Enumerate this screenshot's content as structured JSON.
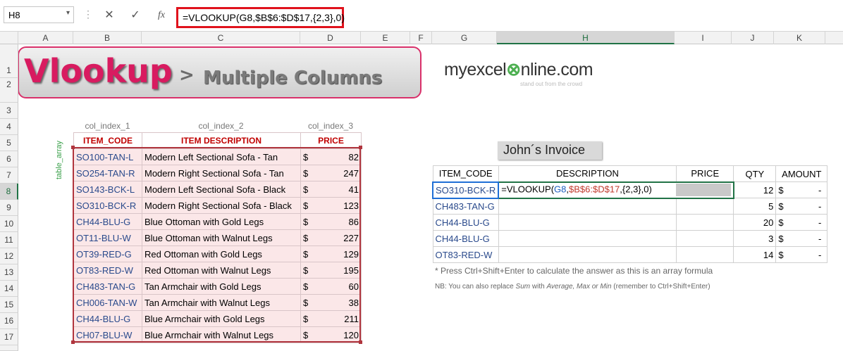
{
  "formula_bar": {
    "name_box": "H8",
    "cancel_icon": "✕",
    "enter_icon": "✓",
    "fx_label": "fx",
    "formula": "=VLOOKUP(G8,$B$6:$D$17,{2,3},0)"
  },
  "columns": [
    "A",
    "B",
    "C",
    "D",
    "E",
    "F",
    "G",
    "H",
    "I",
    "J",
    "K"
  ],
  "rows": [
    "1",
    "2",
    "3",
    "4",
    "5",
    "6",
    "7",
    "8",
    "9",
    "10",
    "11",
    "12",
    "13",
    "14",
    "15",
    "16",
    "17"
  ],
  "selected_cell": {
    "column": "H",
    "row": "8"
  },
  "banner": {
    "main": "Vlookup",
    "arrow": ">",
    "sub": "Multiple Columns"
  },
  "logo": {
    "pre": "myexcel",
    "x": "⊗",
    "post": "nline.com",
    "tagline": "stand out from the crowd"
  },
  "lookup": {
    "index_labels": [
      "col_index_1",
      "col_index_2",
      "col_index_3"
    ],
    "headers": [
      "ITEM_CODE",
      "ITEM DESCRIPTION",
      "PRICE"
    ],
    "array_label": "table_array",
    "currency": "$",
    "rows": [
      {
        "code": "SO100-TAN-L",
        "desc": "Modern Left Sectional Sofa - Tan",
        "price": "82"
      },
      {
        "code": "SO254-TAN-R",
        "desc": "Modern Right Sectional Sofa - Tan",
        "price": "247"
      },
      {
        "code": "SO143-BCK-L",
        "desc": "Modern Left Sectional Sofa - Black",
        "price": "41"
      },
      {
        "code": "SO310-BCK-R",
        "desc": "Modern Right Sectional Sofa - Black",
        "price": "123"
      },
      {
        "code": "CH44-BLU-G",
        "desc": "Blue Ottoman with Gold Legs",
        "price": "86"
      },
      {
        "code": "OT11-BLU-W",
        "desc": "Blue Ottoman with Walnut Legs",
        "price": "227"
      },
      {
        "code": "OT39-RED-G",
        "desc": "Red Ottoman with Gold Legs",
        "price": "129"
      },
      {
        "code": "OT83-RED-W",
        "desc": "Red Ottoman with Walnut Legs",
        "price": "195"
      },
      {
        "code": "CH483-TAN-G",
        "desc": "Tan Armchair with Gold Legs",
        "price": "60"
      },
      {
        "code": "CH006-TAN-W",
        "desc": "Tan Armchair with Walnut Legs",
        "price": "38"
      },
      {
        "code": "CH44-BLU-G",
        "desc": "Blue Armchair with Gold Legs",
        "price": "211"
      },
      {
        "code": "CH07-BLU-W",
        "desc": "Blue Armchair with Walnut Legs",
        "price": "120"
      }
    ]
  },
  "invoice": {
    "title": "John´s Invoice",
    "headers": [
      "ITEM_CODE",
      "DESCRIPTION",
      "PRICE",
      "QTY",
      "AMOUNT"
    ],
    "formula_display": {
      "pre": "=VLOOKUP(",
      "arg1": "G8",
      "comma1": ",",
      "arg2": "$B$6:$D$17",
      "rest": ",{2,3},0)"
    },
    "currency": "$",
    "dash": "-",
    "rows": [
      {
        "code": "SO310-BCK-R",
        "qty": "12"
      },
      {
        "code": "CH483-TAN-G",
        "qty": "5"
      },
      {
        "code": "CH44-BLU-G",
        "qty": "20"
      },
      {
        "code": "CH44-BLU-G",
        "qty": "3"
      },
      {
        "code": "OT83-RED-W",
        "qty": "14"
      }
    ]
  },
  "notes": {
    "line1": "* Press Ctrl+Shift+Enter to calculate the answer as this is an array formula",
    "line2_pre": "NB: You can also replace ",
    "line2_sum": "Sum",
    "line2_mid": "  with ",
    "line2_alts": "Average, Max or Min",
    "line2_post": " (remember to Ctrl+Shift+Enter)"
  }
}
